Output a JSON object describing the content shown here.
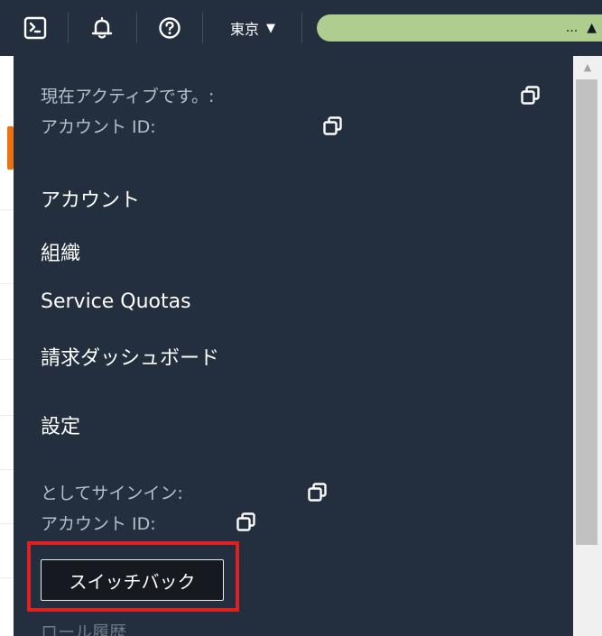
{
  "topbar": {
    "region_label": "東京",
    "region_caret": "▼",
    "account_ellipsis": "...",
    "account_caret": "▲",
    "colors": {
      "bar": "#232f3e",
      "account_pill": "#b0cd90"
    }
  },
  "dropdown": {
    "active_label": "現在アクティブです。:",
    "account_id_label": "アカウント ID:",
    "menu": {
      "account": "アカウント",
      "organization": "組織",
      "service_quotas": "Service Quotas",
      "billing_dashboard": "請求ダッシュボード",
      "settings": "設定"
    },
    "signed_in_as_label": "としてサインイン:",
    "signed_in_account_id_label": "アカウント ID:",
    "switch_back_label": "スイッチバック",
    "role_history_label": "ロール履歴",
    "highlight_color": "#e02020"
  },
  "icons": {
    "cloudshell": "cloudshell-icon",
    "bell": "bell-icon",
    "help": "help-icon",
    "copy": "copy-icon"
  }
}
